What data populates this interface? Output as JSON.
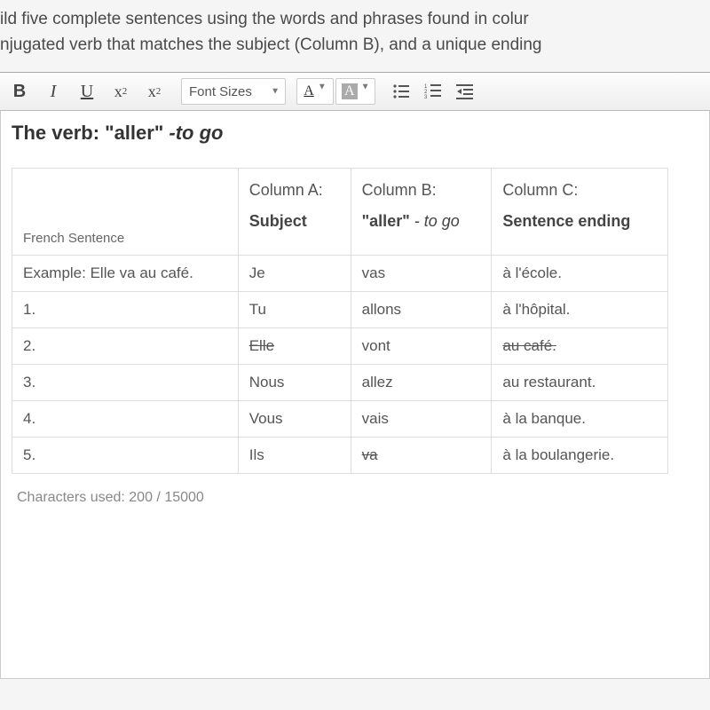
{
  "instructions": {
    "line1": "ild five complete sentences using the words and phrases found in colur",
    "line2": "njugated verb that matches the subject (Column B), and a unique ending"
  },
  "toolbar": {
    "bold": "B",
    "italic": "I",
    "underline": "U",
    "sup_base": "x",
    "sup_exp": "2",
    "sub_base": "x",
    "sub_exp": "2",
    "font_sizes": "Font Sizes",
    "text_color_glyph": "A",
    "bg_color_glyph": "A"
  },
  "editor": {
    "title_prefix": "The verb: \"aller\" ",
    "title_italic": "-to go",
    "headers": {
      "fs": "French Sentence",
      "a_top": "Column A:",
      "a_bot": "Subject",
      "b_top": "Column B:",
      "b_bot_bold": "\"aller\"",
      "b_bot_it": " - to go",
      "c_top": "Column C:",
      "c_bot": "Sentence ending"
    },
    "example_label": "Example: Elle va au café.",
    "rows": [
      {
        "fs": "Example: Elle va au café.",
        "a": "Je",
        "b": "vas",
        "c": "à l'école."
      },
      {
        "fs": "1.",
        "a": "Tu",
        "b": "allons",
        "c": "à l'hôpital."
      },
      {
        "fs": "2.",
        "a": "Elle",
        "b": "vont",
        "c": "au café.",
        "a_strike": true,
        "c_strike": true
      },
      {
        "fs": "3.",
        "a": "Nous",
        "b": "allez",
        "c": "au restaurant."
      },
      {
        "fs": "4.",
        "a": "Vous",
        "b": "vais",
        "c": "à la banque."
      },
      {
        "fs": "5.",
        "a": "Ils",
        "b": "va",
        "c": "à la boulangerie.",
        "b_strike": true
      }
    ]
  },
  "footer": "Characters used: 200 / 15000"
}
